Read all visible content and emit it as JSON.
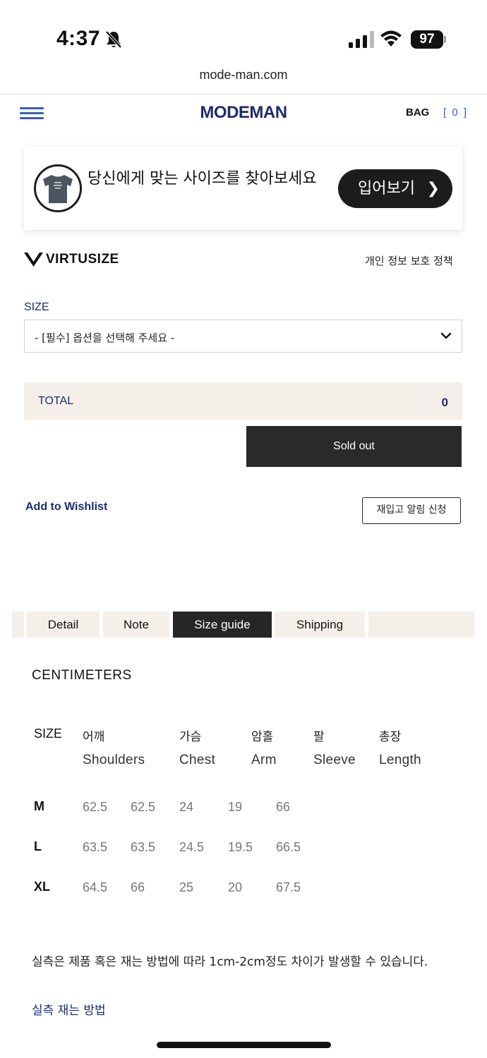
{
  "status_bar": {
    "time": "4:37",
    "battery": "97"
  },
  "browser": {
    "url": "mode-man.com"
  },
  "header": {
    "logo": "MODEMAN",
    "bag_label": "BAG",
    "bag_count": "[ 0 ]"
  },
  "virtusize": {
    "prompt": "당신에게 맞는 사이즈를 찾아보세요",
    "try_button": "입어보기",
    "brand": "VIRTUSIZE",
    "privacy": "개인 정보 보호 정책"
  },
  "options": {
    "size_label": "SIZE",
    "size_value": "- [필수] 옵션을 선택해 주세요 -"
  },
  "total": {
    "label": "TOTAL",
    "value": "0"
  },
  "actions": {
    "sold_out": "Sold out",
    "wishlist": "Add to Wishlist",
    "restock": "재입고 알림 신청"
  },
  "tabs": [
    {
      "label": "Detail",
      "active": false
    },
    {
      "label": "Note",
      "active": false
    },
    {
      "label": "Size guide",
      "active": true
    },
    {
      "label": "Shipping",
      "active": false
    }
  ],
  "size_guide": {
    "units": "CENTIMETERS",
    "size_header": "SIZE",
    "columns": [
      {
        "ko": "어깨",
        "en": "Shoulders"
      },
      {
        "ko": "가슴",
        "en": "Chest"
      },
      {
        "ko": "암홀",
        "en": "Arm"
      },
      {
        "ko": "팔",
        "en": "Sleeve"
      },
      {
        "ko": "총장",
        "en": "Length"
      }
    ],
    "rows": [
      {
        "size": "M",
        "values": [
          "62.5",
          "62.5",
          "24",
          "19",
          "66"
        ]
      },
      {
        "size": "L",
        "values": [
          "63.5",
          "63.5",
          "24.5",
          "19.5",
          "66.5"
        ]
      },
      {
        "size": "XL",
        "values": [
          "64.5",
          "66",
          "25",
          "20",
          "67.5"
        ]
      }
    ],
    "note": "실측은 제품 혹은 재는 방법에 따라 1cm-2cm정도 차이가 발생할 수 있습니다.",
    "how_to_link": "실측 재는 방법"
  }
}
